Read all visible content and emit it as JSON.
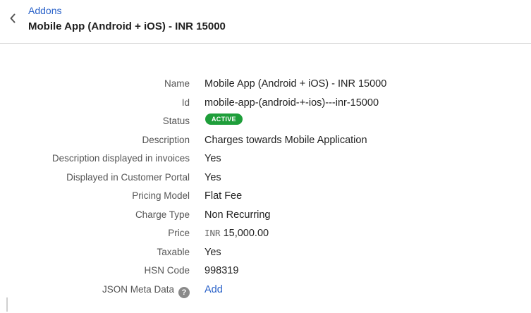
{
  "header": {
    "breadcrumb": "Addons",
    "title": "Mobile App (Android + iOS) - INR 15000",
    "back_icon": "chevron-left-icon"
  },
  "details": {
    "name": {
      "label": "Name",
      "value": "Mobile App (Android + iOS) - INR 15000"
    },
    "id": {
      "label": "Id",
      "value": "mobile-app-(android-+-ios)---inr-15000"
    },
    "status": {
      "label": "Status",
      "value": "ACTIVE",
      "color": "#1e9e3a"
    },
    "description": {
      "label": "Description",
      "value": "Charges towards Mobile Application"
    },
    "desc_invoices": {
      "label": "Description displayed in invoices",
      "value": "Yes"
    },
    "customer_portal": {
      "label": "Displayed in Customer Portal",
      "value": "Yes"
    },
    "pricing_model": {
      "label": "Pricing Model",
      "value": "Flat Fee"
    },
    "charge_type": {
      "label": "Charge Type",
      "value": "Non Recurring"
    },
    "price": {
      "label": "Price",
      "currency": "INR",
      "amount": "15,000.00"
    },
    "taxable": {
      "label": "Taxable",
      "value": "Yes"
    },
    "hsn_code": {
      "label": "HSN Code",
      "value": "998319"
    },
    "json_meta": {
      "label": "JSON Meta Data",
      "help_icon": "question-circle-icon",
      "action": "Add"
    }
  },
  "colors": {
    "link": "#2a62c9",
    "badge": "#1e9e3a"
  }
}
